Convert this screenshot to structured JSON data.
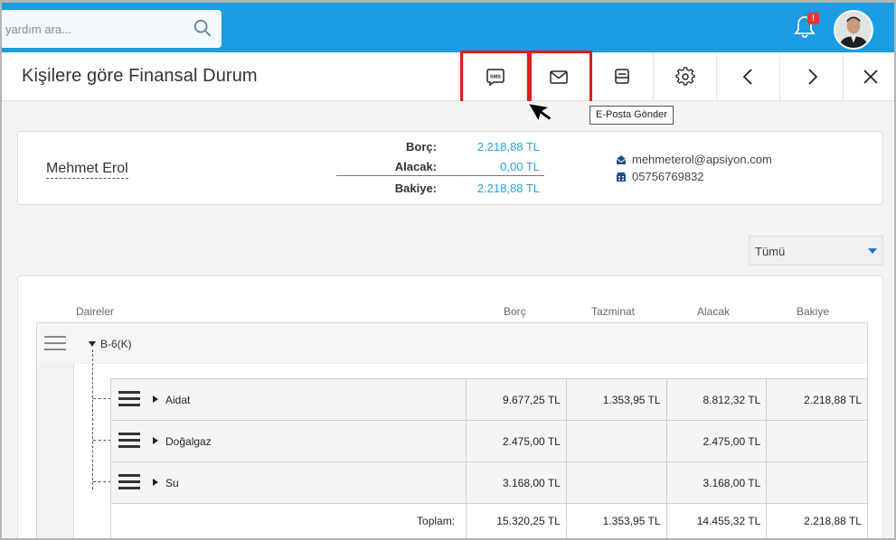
{
  "search": {
    "placeholder": "yardım ara..."
  },
  "notifications": {
    "badge": "!"
  },
  "header": {
    "title": "Kişilere göre Finansal Durum"
  },
  "toolbar": {
    "sms_label": "SMS",
    "tooltip": "E-Posta Gönder"
  },
  "summary": {
    "name": "Mehmet Erol",
    "borc_label": "Borç:",
    "borc_value": "2.218,88 TL",
    "alacak_label": "Alacak:",
    "alacak_value": "0,00 TL",
    "bakiye_label": "Bakiye:",
    "bakiye_value": "2.218,88 TL",
    "email": "mehmeterol@apsiyon.com",
    "phone": "05756769832"
  },
  "filter": {
    "selected": "Tümü"
  },
  "table": {
    "headers": {
      "daireler": "Daireler",
      "borc": "Borç",
      "tazminat": "Tazminat",
      "alacak": "Alacak",
      "bakiye": "Bakiye"
    },
    "group": "B-6(K)",
    "rows": [
      {
        "name": "Aidat",
        "borc": "9.677,25 TL",
        "tazminat": "1.353,95 TL",
        "alacak": "8.812,32 TL",
        "bakiye": "2.218,88 TL"
      },
      {
        "name": "Doğalgaz",
        "borc": "2.475,00 TL",
        "tazminat": "",
        "alacak": "2.475,00 TL",
        "bakiye": ""
      },
      {
        "name": "Su",
        "borc": "3.168,00 TL",
        "tazminat": "",
        "alacak": "3.168,00 TL",
        "bakiye": ""
      }
    ],
    "total": {
      "label": "Toplam:",
      "borc": "15.320,25 TL",
      "tazminat": "1.353,95 TL",
      "alacak": "14.455,32 TL",
      "bakiye": "2.218,88 TL"
    }
  },
  "colors": {
    "accent": "#1b9ce3",
    "highlight": "#e21b1b",
    "value_blue": "#29a3dd"
  }
}
